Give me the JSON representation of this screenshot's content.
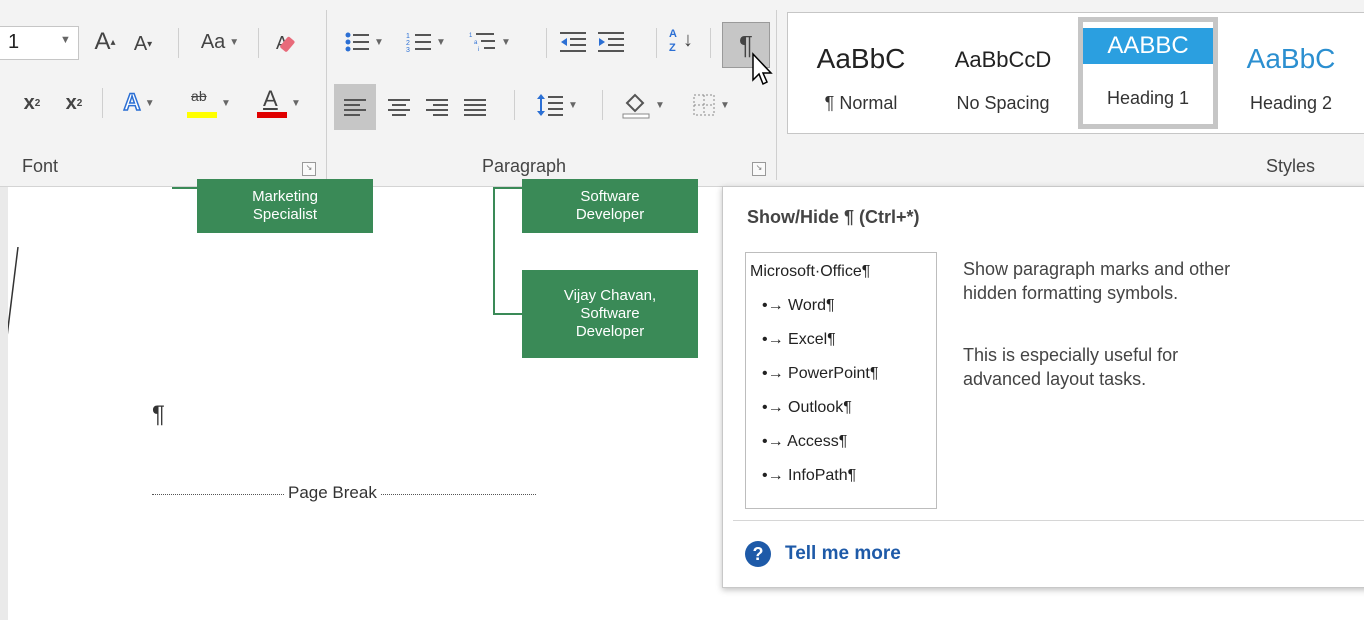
{
  "ribbon": {
    "font": {
      "size_value": "1",
      "grow_icon": "A",
      "shrink_icon": "A",
      "change_case_label": "Aa",
      "subscript_label": "x",
      "superscript_label": "x",
      "text_effects_label": "A",
      "highlight_label": "ab",
      "font_color_label": "A",
      "group_label": "Font"
    },
    "paragraph": {
      "group_label": "Paragraph",
      "sort_label": "A Z",
      "pilcrow": "¶"
    },
    "styles": {
      "group_label": "Styles",
      "items": [
        {
          "sample": "AaBbC",
          "name": "¶ Normal"
        },
        {
          "sample": "AaBbCcD",
          "name": "No Spacing"
        },
        {
          "sample": "AABBC",
          "name": "Heading 1"
        },
        {
          "sample": "AaBbC",
          "name": "Heading 2"
        }
      ]
    }
  },
  "document": {
    "org": {
      "box1": "Marketing\nSpecialist",
      "box2": "Software\nDeveloper",
      "box3": "Vijay Chavan,\nSoftware\nDeveloper"
    },
    "pilcrow": "¶",
    "page_break": "Page Break"
  },
  "tooltip": {
    "title": "Show/Hide ¶ (Ctrl+*)",
    "sample": {
      "heading": "Microsoft·Office¶",
      "items": [
        "•→ Word¶",
        "•→ Excel¶",
        "•→ PowerPoint¶",
        "•→ Outlook¶",
        "•→ Access¶",
        "•→ InfoPath¶"
      ]
    },
    "desc1_line1": "Show paragraph marks and other",
    "desc1_line2": "hidden formatting symbols.",
    "desc2_line1": "This is especially useful for",
    "desc2_line2": "advanced layout tasks.",
    "tell_me_more": "Tell me more",
    "help_icon_glyph": "?"
  },
  "colors": {
    "accent_blue": "#2b9fe0",
    "org_green": "#3a8a57",
    "highlight_yellow": "#ffff00",
    "font_red": "#e00000",
    "link_blue": "#1e5aa8"
  }
}
